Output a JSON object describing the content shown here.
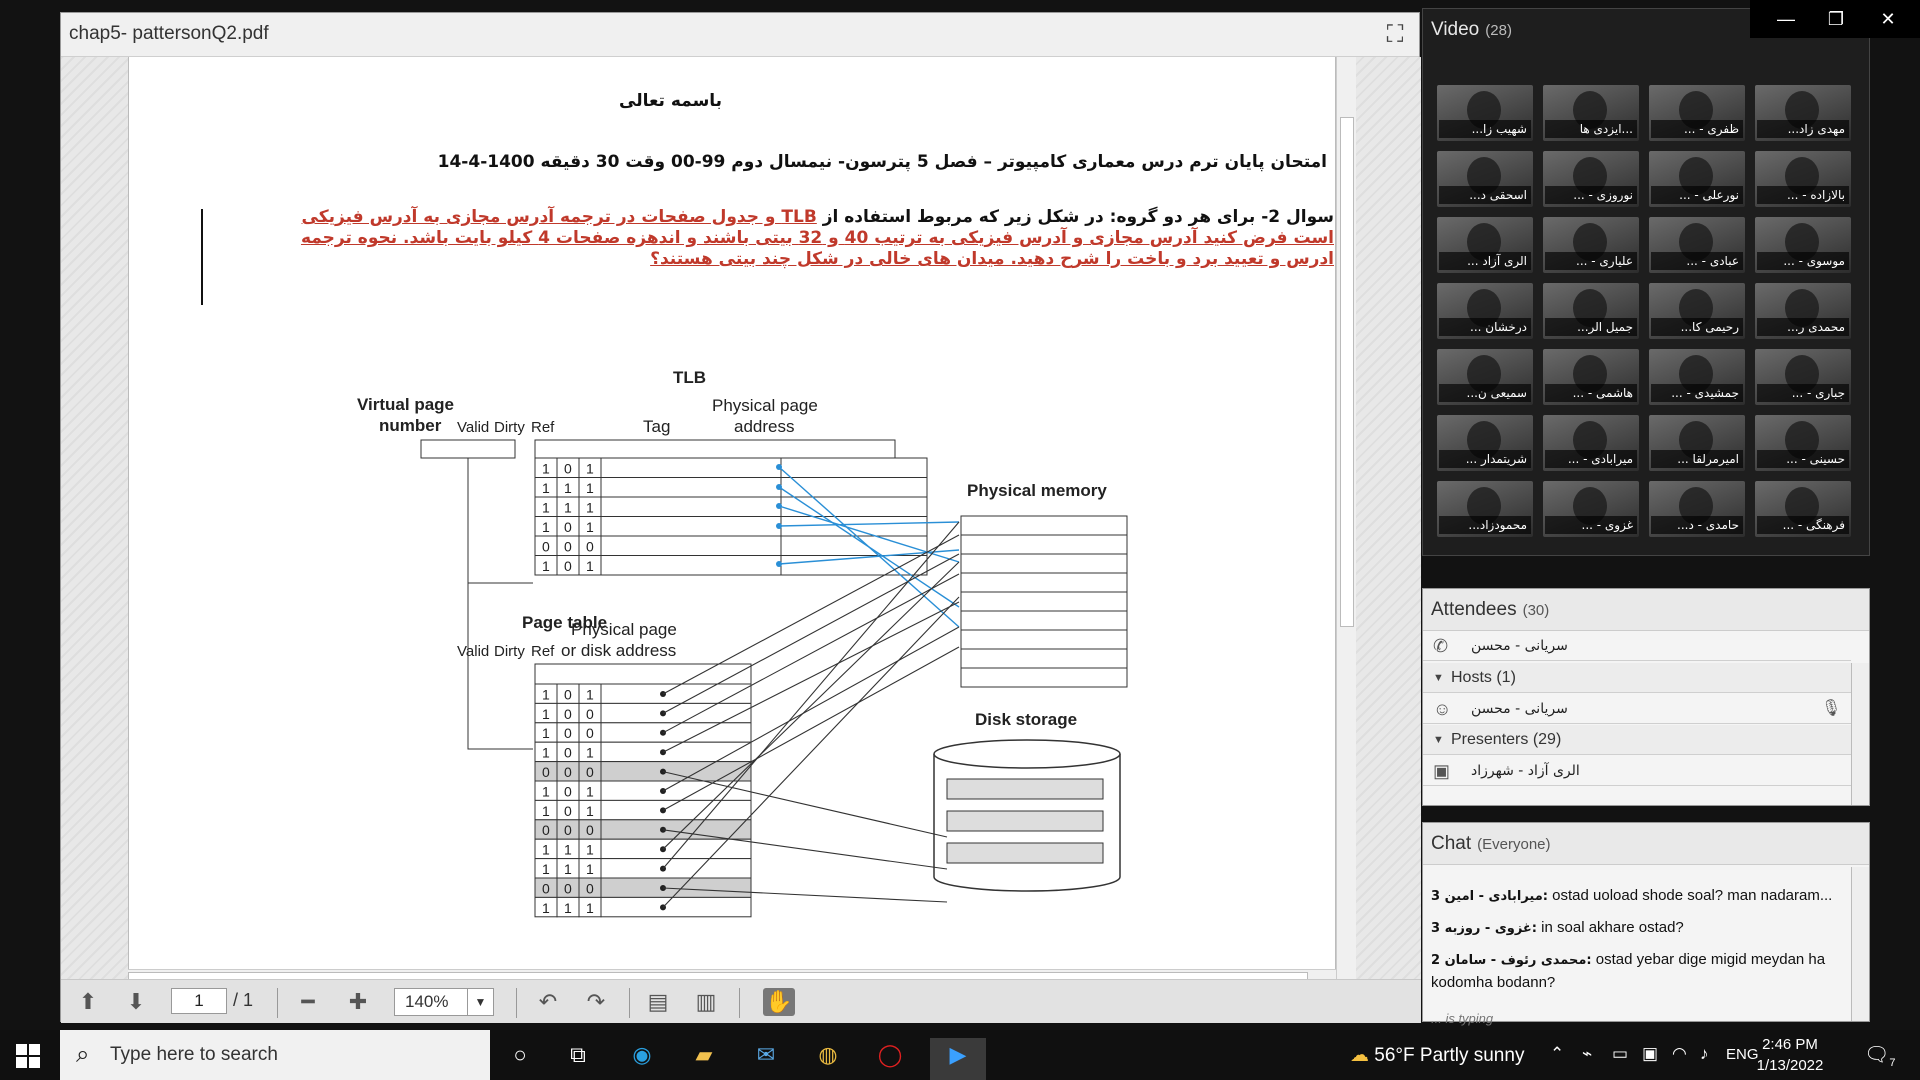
{
  "pdf": {
    "title": "chap5- pattersonQ2.pdf",
    "page_current": "1",
    "page_total": "/ 1",
    "zoom": "140%",
    "doc": {
      "bismillah": "باسمه تعالی",
      "header": "امتحان پایان ترم درس معماری کامپیوتر – فصل 5 پترسون- نیمسال دوم 99-00      وقت 30 دقیقه      1400-4-14",
      "q_prefix": "سوال 2-  برای هر دو گروه: در شکل زیر که مربوط استفاده از ",
      "q_highlight": "TLB و جدول صفحات در ترجمه آدرس مجازی به آدرس فیزیکی است فرض کنید آدرس مجازی و آدرس فیزیکی به ترتیب 40 و 32 بیتی باشند و اندهزه صفحات 4 کیلو بایت باشد. نحوه ترجمه ادرس و تعیید برد و باخت را شرح دهید. میدان های خالی در شکل چند بیتی هستند؟"
    },
    "diagram": {
      "tlb_title": "TLB",
      "vpn_label_1": "Virtual page",
      "vpn_label_2": "number",
      "tlb_cols": [
        "Valid",
        "Dirty",
        "Ref"
      ],
      "tag": "Tag",
      "ppa_1": "Physical page",
      "ppa_2": "address",
      "tlb_rows": [
        [
          "1",
          "0",
          "1"
        ],
        [
          "1",
          "1",
          "1"
        ],
        [
          "1",
          "1",
          "1"
        ],
        [
          "1",
          "0",
          "1"
        ],
        [
          "0",
          "0",
          "0"
        ],
        [
          "1",
          "0",
          "1"
        ]
      ],
      "pt_title": "Page table",
      "pt_cols": [
        "Valid",
        "Dirty",
        "Ref"
      ],
      "pt_ppa_1": "Physical page",
      "pt_ppa_2": "or disk address",
      "pt_rows": [
        [
          "1",
          "0",
          "1"
        ],
        [
          "1",
          "0",
          "0"
        ],
        [
          "1",
          "0",
          "0"
        ],
        [
          "1",
          "0",
          "1"
        ],
        [
          "0",
          "0",
          "0"
        ],
        [
          "1",
          "0",
          "1"
        ],
        [
          "1",
          "0",
          "1"
        ],
        [
          "0",
          "0",
          "0"
        ],
        [
          "1",
          "1",
          "1"
        ],
        [
          "1",
          "1",
          "1"
        ],
        [
          "0",
          "0",
          "0"
        ],
        [
          "1",
          "1",
          "1"
        ]
      ],
      "phys_mem": "Physical memory",
      "disk": "Disk storage"
    }
  },
  "video": {
    "title": "Video",
    "count": "(28)",
    "tiles": [
      "شهیب زا...",
      "...ایزدی ها",
      "ظفری - ...",
      "مهدی زاد...",
      "اسحقی د...",
      "نوروزی - ...",
      "نورعلی - ...",
      "بالازاده - ...",
      "الری آزاد ...",
      "علیاری - ...",
      "عبادی - ...",
      "موسوی - ...",
      "درخشان ...",
      "جمیل الر...",
      "رحیمی کا...",
      "محمدی ر...",
      "سمیعی ن...",
      "هاشمی - ...",
      "جمشیدی - ...",
      "جباری - ...",
      "شریتمدار ...",
      "میرابادی - ...",
      "امیرمرلقا ...",
      "حسینی - ...",
      "محمودزاد...",
      "غزوی - ...",
      "حامدی - د...",
      "فرهنگی - ..."
    ]
  },
  "attendees": {
    "title": "Attendees",
    "count": "(30)",
    "me": "سریانی - محسن",
    "hosts_label": "Hosts (1)",
    "host": "سریانی - محسن",
    "presenters_label": "Presenters (29)",
    "presenter_1": "الری آزاد - شهرزاد"
  },
  "chat": {
    "title": "Chat",
    "scope": "(Everyone)",
    "messages": [
      {
        "sender": "میرابادی - امین 3:",
        "text": " ostad uoload shode soal? man nadaram..."
      },
      {
        "sender": "غزوی - روزبه 3:",
        "text": " in soal akhare ostad?"
      },
      {
        "sender": "محمدی رئوف - سامان 2:",
        "text": " ostad yebar dige migid meydan ha kodomha bodann?"
      }
    ],
    "typing": "... is typing"
  },
  "taskbar": {
    "search_placeholder": "Type here to search",
    "weather": "56°F  Partly sunny",
    "lang": "ENG",
    "time": "2:46 PM",
    "date": "1/13/2022",
    "notif_count": "7"
  },
  "colors": {
    "highlight_red": "#c0392b",
    "tlb_link": "#2a8fd6",
    "accent_blue": "#0078d7"
  }
}
